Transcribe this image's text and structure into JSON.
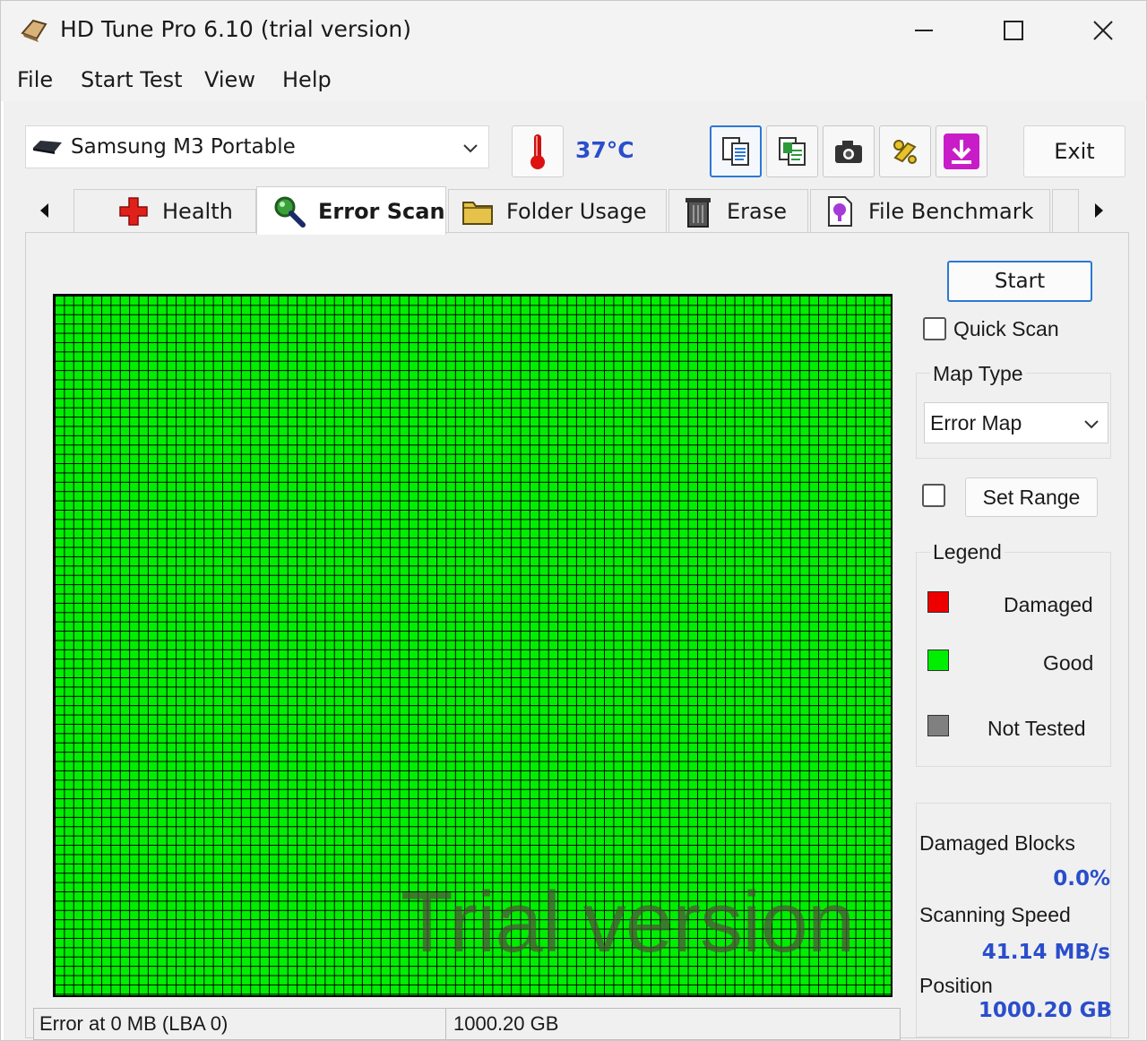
{
  "window": {
    "title": "HD Tune Pro 6.10 (trial version)"
  },
  "menu": [
    "File",
    "Start Test",
    "View",
    "Help"
  ],
  "toolbar": {
    "drive": "Samsung M3 Portable",
    "temperature": "37°C",
    "exit_label": "Exit",
    "buttons": [
      "copy-text-icon",
      "copy-info-icon",
      "camera-icon",
      "options-icon",
      "download-icon"
    ]
  },
  "tabs": [
    {
      "label": "Health",
      "icon": "health-cross-icon"
    },
    {
      "label": "Error Scan",
      "icon": "magnifier-icon",
      "selected": true
    },
    {
      "label": "Folder Usage",
      "icon": "folder-icon"
    },
    {
      "label": "Erase",
      "icon": "trash-icon"
    },
    {
      "label": "File Benchmark",
      "icon": "file-benchmark-icon"
    }
  ],
  "scan": {
    "start_label": "Start",
    "quick_scan_label": "Quick Scan",
    "quick_scan_checked": false,
    "map_type_label": "Map Type",
    "map_type_value": "Error Map",
    "set_range_label": "Set Range",
    "set_range_checked": false,
    "watermark": "Trial version"
  },
  "legend": {
    "title": "Legend",
    "items": [
      {
        "label": "Damaged",
        "color": "#ee0000"
      },
      {
        "label": "Good",
        "color": "#00ee00"
      },
      {
        "label": "Not Tested",
        "color": "#808080"
      }
    ]
  },
  "stats": {
    "damaged_blocks_label": "Damaged Blocks",
    "damaged_blocks_value": "0.0%",
    "scanning_speed_label": "Scanning Speed",
    "scanning_speed_value": "41.14 MB/s",
    "position_label": "Position",
    "position_value": "1000.20 GB"
  },
  "status_bar": {
    "error_text": "Error at 0 MB (LBA 0)",
    "capacity": "1000.20 GB"
  },
  "colors": {
    "accent": "#2c78d4",
    "value_blue": "#2a4ecb",
    "good": "#00ee00",
    "damaged": "#ee0000",
    "not_tested": "#808080"
  }
}
